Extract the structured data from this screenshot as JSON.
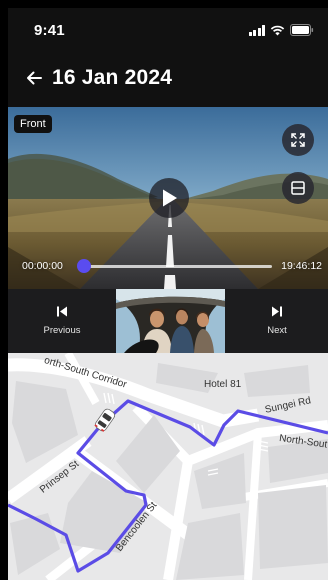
{
  "status_bar": {
    "time": "9:41"
  },
  "header": {
    "title": "16 Jan 2024"
  },
  "video": {
    "camera_badge": "Front",
    "time_start": "00:00:00",
    "time_end": "19:46:12",
    "progress_fraction": 0.0
  },
  "controls": {
    "previous_label": "Previous",
    "next_label": "Next"
  },
  "map": {
    "labels": {
      "corridor": "orth-South Corridor",
      "hotel": "Hotel 81",
      "sungei": "Sungei Rd",
      "north_south": "North-Sout",
      "prinsep": "Prinsep St",
      "bencoolen": "Bencoolen St"
    },
    "route_color": "#5b4ce6"
  },
  "colors": {
    "accent": "#5a4cf0",
    "background": "#1c1c1e"
  },
  "icons": [
    "back-arrow-icon",
    "expand-icon",
    "split-view-icon",
    "play-icon",
    "previous-icon",
    "next-icon",
    "signal-icon",
    "wifi-icon",
    "battery-icon",
    "car-icon"
  ]
}
